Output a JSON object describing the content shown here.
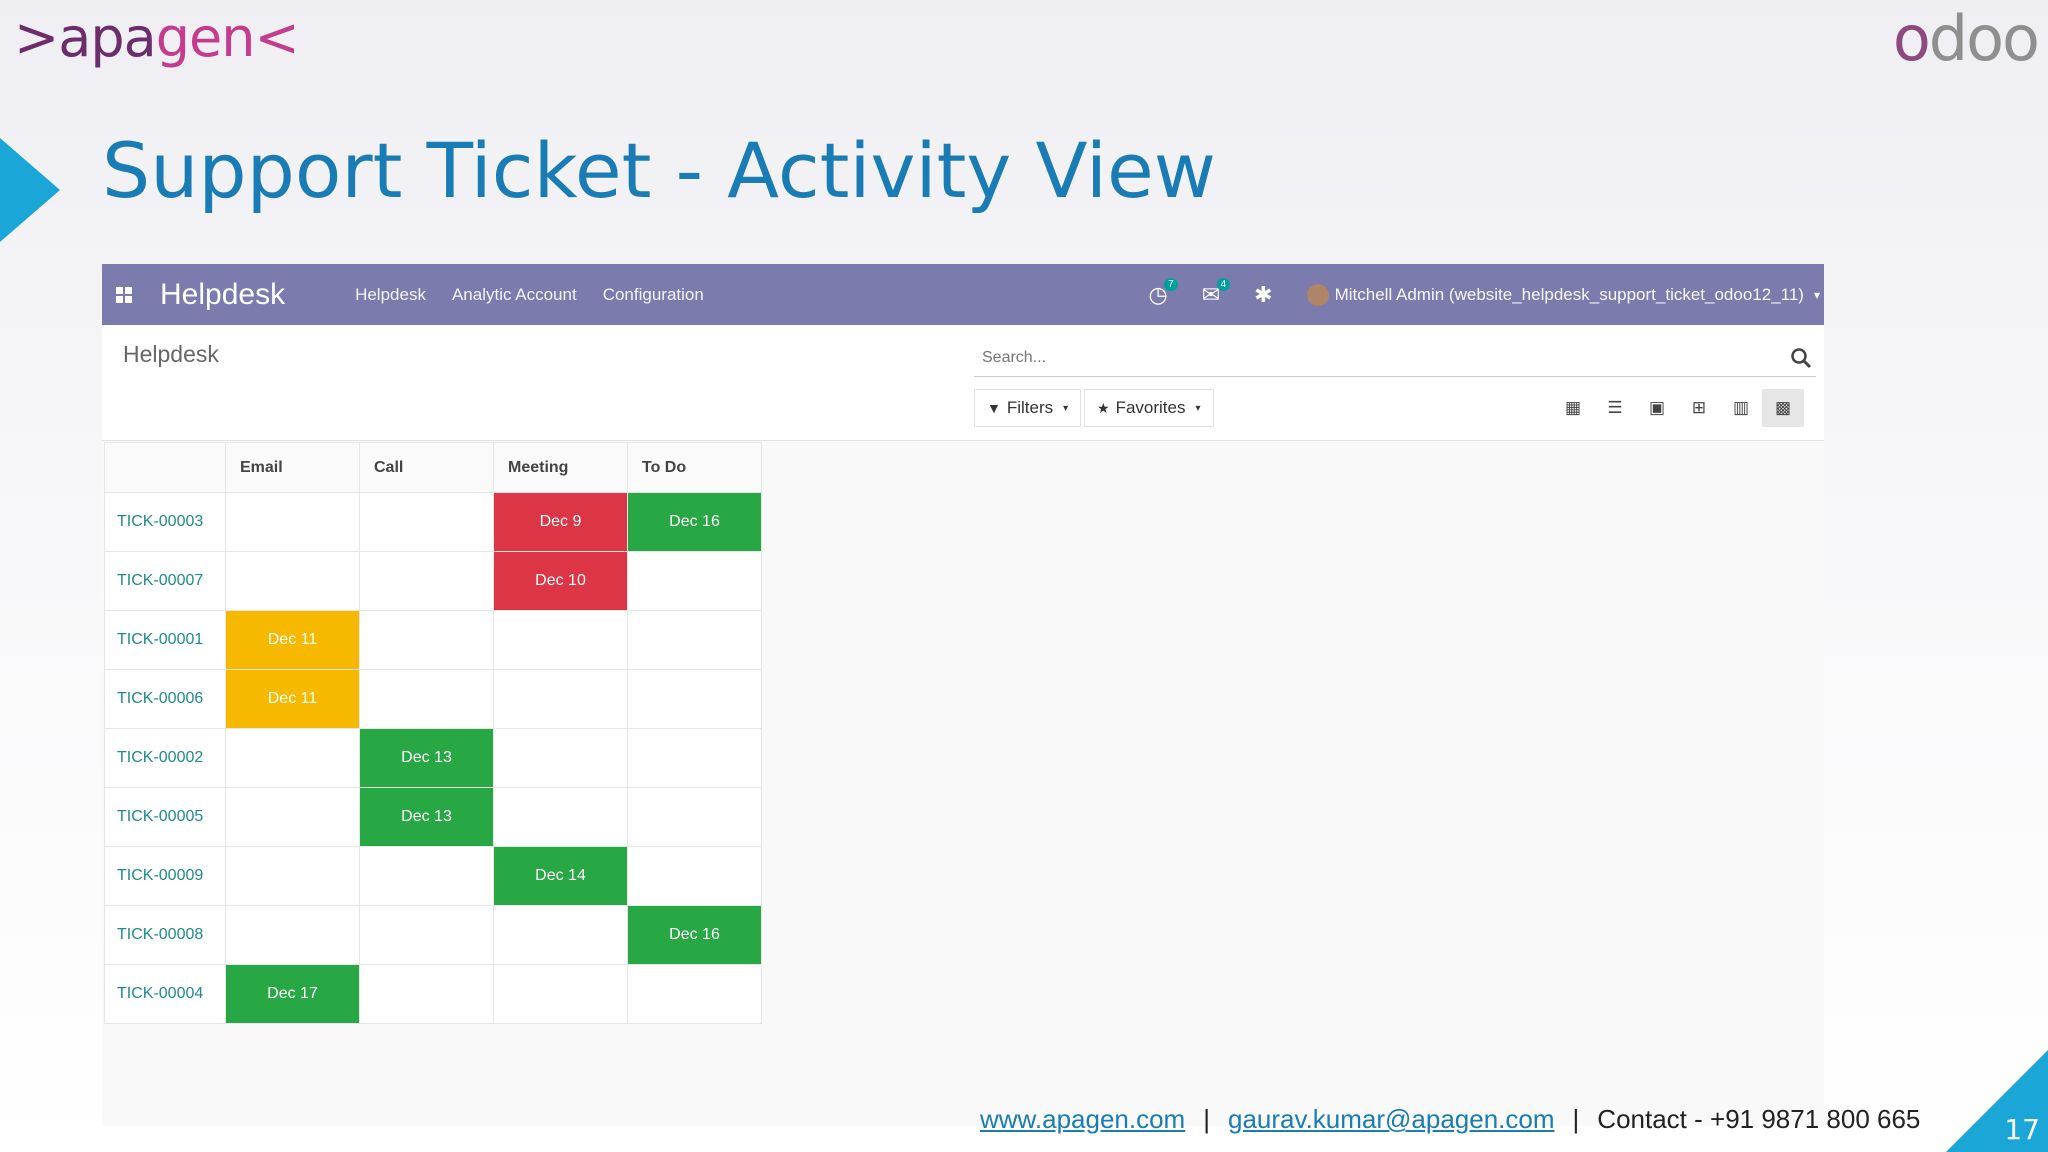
{
  "slide": {
    "brand_left_a": ">apa",
    "brand_left_b": "gen<",
    "brand_right_a": "o",
    "brand_right_b": "doo",
    "title": "Support Ticket - Activity View",
    "footer": {
      "website": "www.apagen.com",
      "email": "gaurav.kumar@apagen.com",
      "contact_label": "Contact",
      "phone": "+91 9871 800 665"
    },
    "page_number": "17",
    "accent_color": "#1aa7d8"
  },
  "navbar": {
    "app_name": "Helpdesk",
    "menus": [
      "Helpdesk",
      "Analytic Account",
      "Configuration"
    ],
    "activity_badge": "7",
    "messages_badge": "4",
    "user": "Mitchell Admin (website_helpdesk_support_ticket_odoo12_11)",
    "color": "#7c7bad"
  },
  "control_panel": {
    "breadcrumb": "Helpdesk",
    "search_placeholder": "Search...",
    "filters_label": "Filters",
    "favorites_label": "Favorites",
    "views": [
      "kanban",
      "list",
      "calendar",
      "pivot",
      "graph",
      "activity"
    ],
    "active_view": "activity"
  },
  "activity": {
    "columns": [
      "Email",
      "Call",
      "Meeting",
      "To Do"
    ],
    "rows": [
      {
        "ref": "TICK-00003",
        "cells": [
          {
            "text": "",
            "status": ""
          },
          {
            "text": "",
            "status": ""
          },
          {
            "text": "Dec 9",
            "status": "red"
          },
          {
            "text": "Dec 16",
            "status": "green"
          }
        ]
      },
      {
        "ref": "TICK-00007",
        "cells": [
          {
            "text": "",
            "status": ""
          },
          {
            "text": "",
            "status": ""
          },
          {
            "text": "Dec 10",
            "status": "red"
          },
          {
            "text": "",
            "status": ""
          }
        ]
      },
      {
        "ref": "TICK-00001",
        "cells": [
          {
            "text": "Dec 11",
            "status": "orange"
          },
          {
            "text": "",
            "status": ""
          },
          {
            "text": "",
            "status": ""
          },
          {
            "text": "",
            "status": ""
          }
        ]
      },
      {
        "ref": "TICK-00006",
        "cells": [
          {
            "text": "Dec 11",
            "status": "orange"
          },
          {
            "text": "",
            "status": ""
          },
          {
            "text": "",
            "status": ""
          },
          {
            "text": "",
            "status": ""
          }
        ]
      },
      {
        "ref": "TICK-00002",
        "cells": [
          {
            "text": "",
            "status": ""
          },
          {
            "text": "Dec 13",
            "status": "green"
          },
          {
            "text": "",
            "status": ""
          },
          {
            "text": "",
            "status": ""
          }
        ]
      },
      {
        "ref": "TICK-00005",
        "cells": [
          {
            "text": "",
            "status": ""
          },
          {
            "text": "Dec 13",
            "status": "green"
          },
          {
            "text": "",
            "status": ""
          },
          {
            "text": "",
            "status": ""
          }
        ]
      },
      {
        "ref": "TICK-00009",
        "cells": [
          {
            "text": "",
            "status": ""
          },
          {
            "text": "",
            "status": ""
          },
          {
            "text": "Dec 14",
            "status": "green"
          },
          {
            "text": "",
            "status": ""
          }
        ]
      },
      {
        "ref": "TICK-00008",
        "cells": [
          {
            "text": "",
            "status": ""
          },
          {
            "text": "",
            "status": ""
          },
          {
            "text": "",
            "status": ""
          },
          {
            "text": "Dec 16",
            "status": "green"
          }
        ]
      },
      {
        "ref": "TICK-00004",
        "cells": [
          {
            "text": "Dec 17",
            "status": "green"
          },
          {
            "text": "",
            "status": ""
          },
          {
            "text": "",
            "status": ""
          },
          {
            "text": "",
            "status": ""
          }
        ]
      }
    ],
    "status_colors": {
      "red": "#dc3545",
      "green": "#28a745",
      "orange": "#f6b900"
    }
  }
}
